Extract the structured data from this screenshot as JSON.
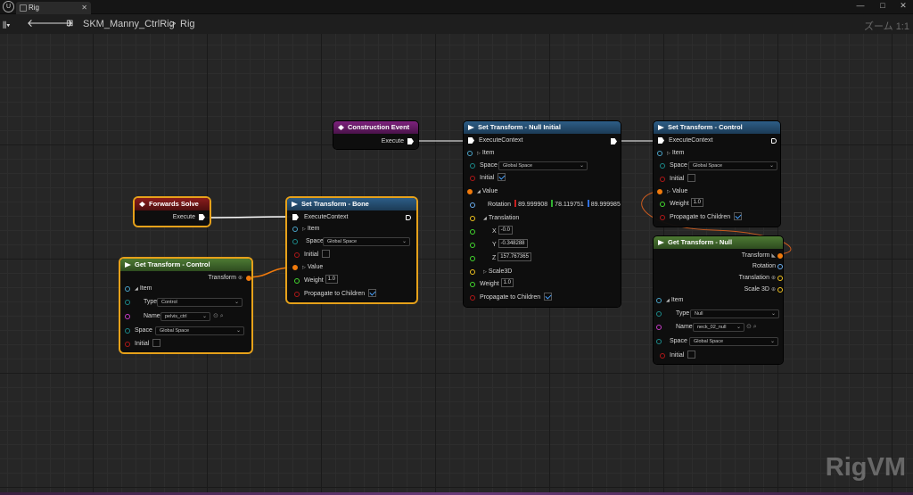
{
  "titlebar": {
    "tab_label": "Rig",
    "minimize": "—",
    "maximize": "□",
    "close": "✕"
  },
  "navbar": {
    "asset": "SKM_Manny_CtrlRig",
    "separator": ">",
    "graph": "Rig",
    "zoom": "ズーム 1:1"
  },
  "watermark": "RigVM",
  "nodes": {
    "construction": {
      "title": "Construction Event",
      "execute": "Execute"
    },
    "forwards": {
      "title": "Forwards Solve",
      "execute": "Execute"
    },
    "get_control": {
      "title": "Get Transform - Control",
      "transform": "Transform",
      "item": "Item",
      "type_label": "Type",
      "type_value": "Control",
      "name_label": "Name",
      "name_value": "pelvis_ctrl",
      "space_label": "Space",
      "space_value": "Global Space",
      "initial": "Initial"
    },
    "set_bone": {
      "title": "Set Transform - Bone",
      "execute_context": "ExecuteContext",
      "item": "Item",
      "space_label": "Space",
      "space_value": "Global Space",
      "initial": "Initial",
      "value": "Value",
      "weight_label": "Weight",
      "weight_value": "1.0",
      "propagate": "Propagate to Children"
    },
    "set_null": {
      "title": "Set Transform - Null Initial",
      "execute_context": "ExecuteContext",
      "item": "Item",
      "space_label": "Space",
      "space_value": "Global Space",
      "initial": "Initial",
      "value": "Value",
      "rotation_label": "Rotation",
      "rot_x": "89.999908",
      "rot_y": "78.119751",
      "rot_z": "89.999985",
      "translation": "Translation",
      "x_label": "X",
      "x_value": "-0.0",
      "y_label": "Y",
      "y_value": "-0.348288",
      "z_label": "Z",
      "z_value": "157.767365",
      "scale3d": "Scale3D",
      "weight_label": "Weight",
      "weight_value": "1.0",
      "propagate": "Propagate to Children"
    },
    "set_control": {
      "title": "Set Transform - Control",
      "execute_context": "ExecuteContext",
      "item": "Item",
      "space_label": "Space",
      "space_value": "Global Space",
      "initial": "Initial",
      "value": "Value",
      "weight_label": "Weight",
      "weight_value": "1.0",
      "propagate": "Propagate to Children"
    },
    "get_null": {
      "title": "Get Transform - Null",
      "transform": "Transform",
      "rotation": "Rotation",
      "translation": "Translation",
      "scale3d": "Scale 3D",
      "item": "Item",
      "type_label": "Type",
      "type_value": "Null",
      "name_label": "Name",
      "name_value": "neck_02_null",
      "space_label": "Space",
      "space_value": "Global Space",
      "initial": "Initial"
    }
  },
  "colors": {
    "exec": "#ffffff",
    "struct": "#4aa3c8",
    "bool": "#b01818",
    "transform": "#f07a0c",
    "vector": "#f0c21f",
    "name": "#c83cc8",
    "float": "#43d82f",
    "rotator": "#6aaef0"
  }
}
